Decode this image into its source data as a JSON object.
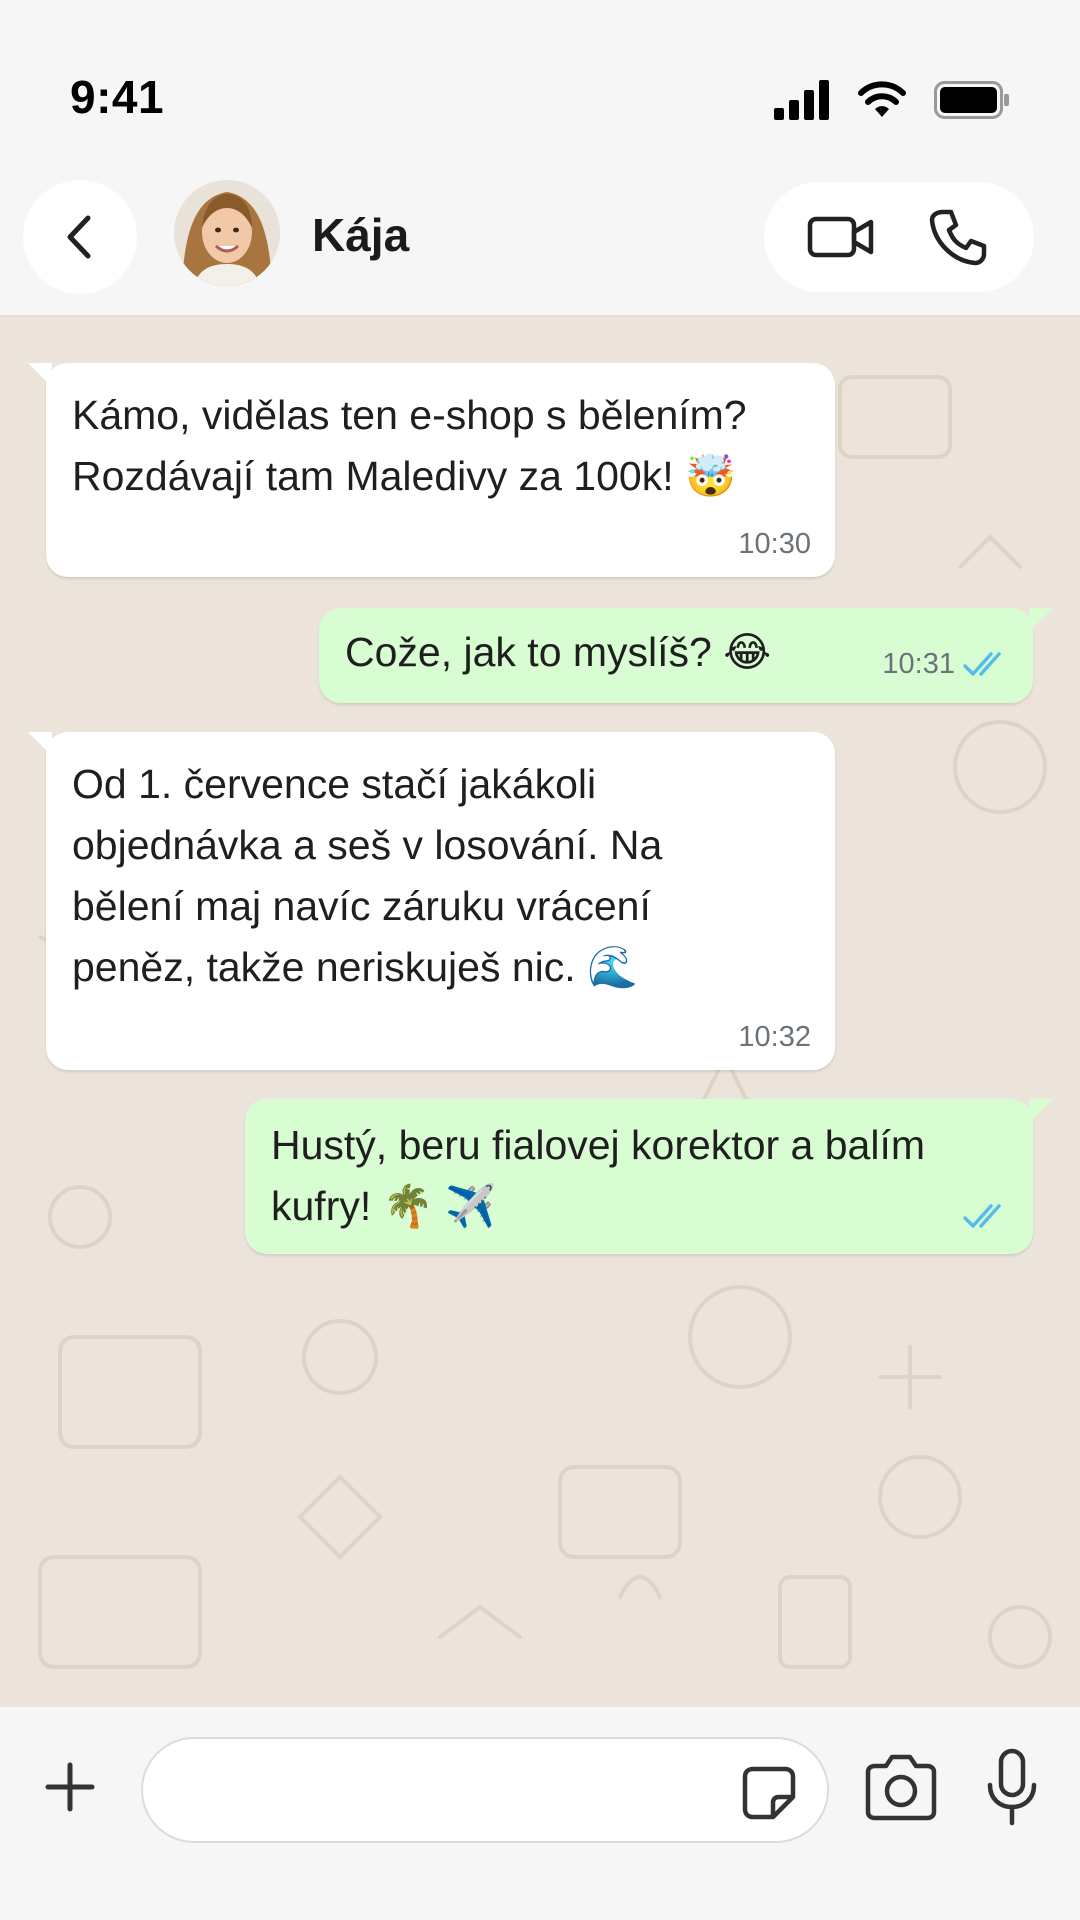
{
  "status_bar": {
    "time": "9:41"
  },
  "header": {
    "contact_name": "Kája"
  },
  "messages": [
    {
      "direction": "in",
      "text": "Kámo, vidělas ten e-shop s bělením? Rozdávají tam Maledivy za 100k! 🤯",
      "time": "10:30"
    },
    {
      "direction": "out",
      "text": "Cože, jak to myslíš? 😂",
      "time": "10:31",
      "read": true
    },
    {
      "direction": "in",
      "text": "Od 1. července stačí jakákoli objednávka a seš v losování. Na bělení maj navíc záruku vrácení peněz, takže neriskuješ nic. 🌊",
      "time": "10:32"
    },
    {
      "direction": "out",
      "text": "Hustý, beru fialovej korektor a balím kufry! 🌴 ✈️",
      "time": "",
      "read": true
    }
  ],
  "input": {
    "value": "",
    "placeholder": ""
  },
  "colors": {
    "incoming": "#ffffff",
    "outgoing": "#d9fdd3",
    "read_ticks": "#53bdeb",
    "chat_bg": "#ece4da"
  }
}
